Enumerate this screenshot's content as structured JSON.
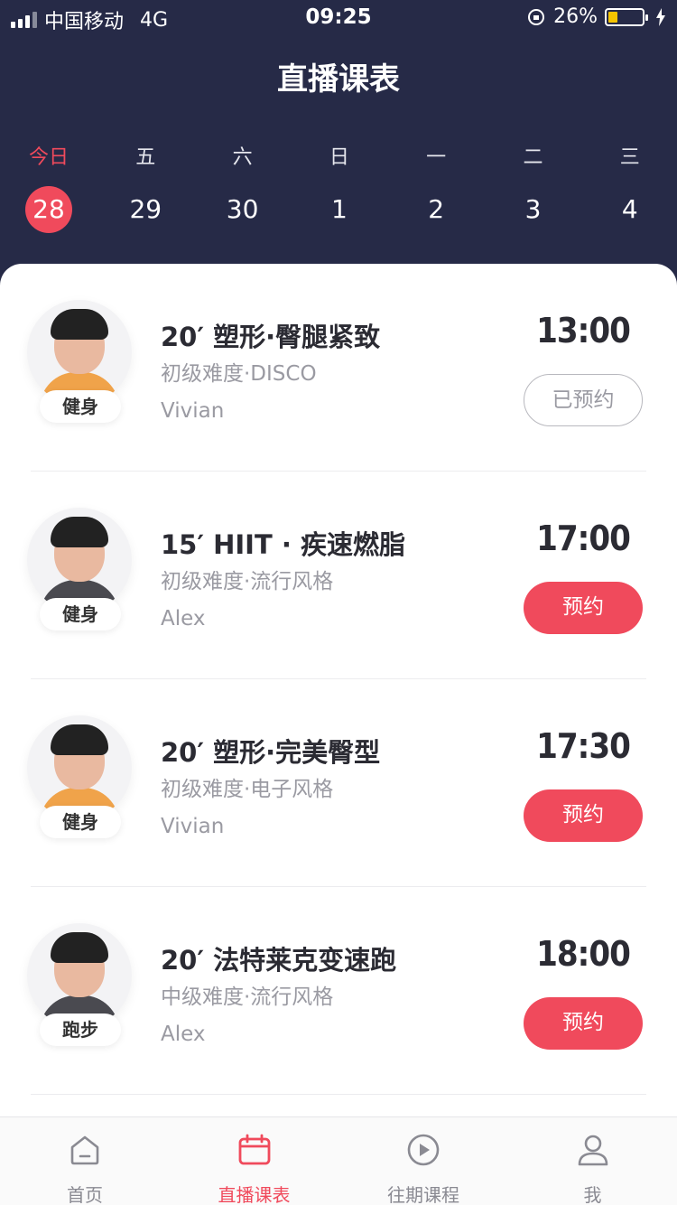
{
  "status_bar": {
    "carrier": "中国移动",
    "network": "4G",
    "time": "09:25",
    "battery": "26%"
  },
  "header": {
    "title": "直播课表"
  },
  "week": [
    {
      "dow": "今日",
      "date": "28",
      "today": true
    },
    {
      "dow": "五",
      "date": "29"
    },
    {
      "dow": "六",
      "date": "30"
    },
    {
      "dow": "日",
      "date": "1"
    },
    {
      "dow": "一",
      "date": "2"
    },
    {
      "dow": "二",
      "date": "3"
    },
    {
      "dow": "三",
      "date": "4"
    }
  ],
  "courses": [
    {
      "title": "20′ 塑形·臀腿紧致",
      "subtitle": "初级难度·DISCO",
      "coach": "Vivian",
      "tag": "健身",
      "time": "13:00",
      "button": "已预约",
      "booked": true,
      "avatar": "female-coach-avatar"
    },
    {
      "title": "15′ HIIT · 疾速燃脂",
      "subtitle": "初级难度·流行风格",
      "coach": "Alex",
      "tag": "健身",
      "time": "17:00",
      "button": "预约",
      "booked": false,
      "avatar": "male-coach-avatar"
    },
    {
      "title": "20′ 塑形·完美臀型",
      "subtitle": "初级难度·电子风格",
      "coach": "Vivian",
      "tag": "健身",
      "time": "17:30",
      "button": "预约",
      "booked": false,
      "avatar": "female-coach-avatar"
    },
    {
      "title": "20′ 法特莱克变速跑",
      "subtitle": "中级难度·流行风格",
      "coach": "Alex",
      "tag": "跑步",
      "time": "18:00",
      "button": "预约",
      "booked": false,
      "avatar": "male-coach-avatar"
    }
  ],
  "tabbar": [
    {
      "label": "首页",
      "icon": "home-icon",
      "active": false
    },
    {
      "label": "直播课表",
      "icon": "calendar-icon",
      "active": true
    },
    {
      "label": "往期课程",
      "icon": "play-icon",
      "active": false
    },
    {
      "label": "我",
      "icon": "user-icon",
      "active": false
    }
  ],
  "colors": {
    "header_bg": "#262a47",
    "accent": "#f04a5c"
  }
}
